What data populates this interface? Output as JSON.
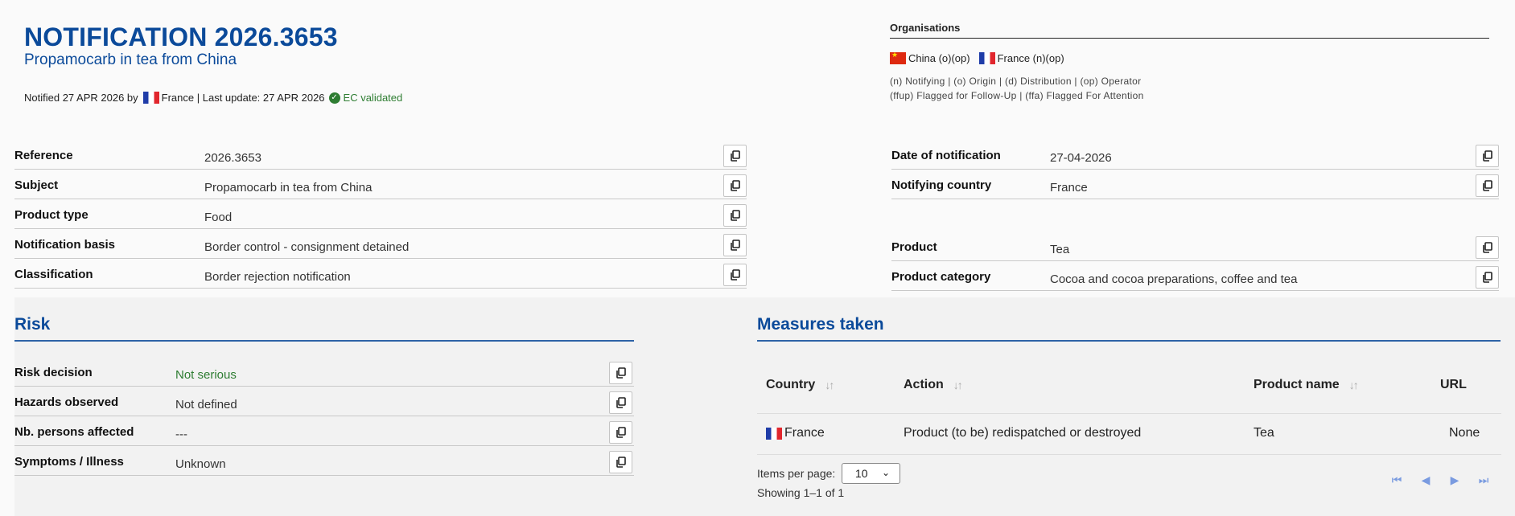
{
  "header": {
    "title": "NOTIFICATION 2026.3653",
    "subtitle": "Propamocarb in tea from China",
    "notified_prefix": "Notified 27 APR 2026 by",
    "notified_country": "France",
    "last_update": "| Last update: 27 APR 2026",
    "validated": "EC validated"
  },
  "organisations": {
    "title": "Organisations",
    "entries": [
      {
        "country": "China (o)(op)",
        "flag": "flag-china"
      },
      {
        "country": "France (n)(op)",
        "flag": "flag-france"
      }
    ],
    "legend_line1": "(n) Notifying | (o) Origin | (d) Distribution | (op) Operator",
    "legend_line2": "(ffup) Flagged for Follow-Up | (ffa) Flagged For Attention"
  },
  "fields_left": [
    {
      "label": "Reference",
      "value": "2026.3653"
    },
    {
      "label": "Subject",
      "value": "Propamocarb in tea from China"
    },
    {
      "label": "Product type",
      "value": "Food"
    },
    {
      "label": "Notification basis",
      "value": "Border control - consignment detained"
    },
    {
      "label": "Classification",
      "value": "Border rejection notification"
    }
  ],
  "fields_right": [
    {
      "label": "Date of notification",
      "value": "27-04-2026"
    },
    {
      "label": "Notifying country",
      "value": "France"
    },
    {
      "label": "Product",
      "value": "Tea"
    },
    {
      "label": "Product category",
      "value": "Cocoa and cocoa preparations, coffee and tea"
    }
  ],
  "risk": {
    "title": "Risk",
    "fields": [
      {
        "label": "Risk decision",
        "value": "Not serious",
        "color": "#2e7d32"
      },
      {
        "label": "Hazards observed",
        "value": "Not defined"
      },
      {
        "label": "Nb. persons affected",
        "value": "---"
      },
      {
        "label": "Symptoms / Illness",
        "value": "Unknown"
      }
    ]
  },
  "measures": {
    "title": "Measures taken",
    "columns": [
      "Country",
      "Action",
      "Product name",
      "URL"
    ],
    "rows": [
      {
        "country": "France",
        "action": "Product (to be) redispatched or destroyed",
        "product_name": "Tea",
        "url": "None"
      }
    ],
    "items_per_page_label": "Items per page:",
    "items_per_page_value": "10",
    "showing": "Showing 1–1 of 1"
  },
  "icons": {
    "copy": "copy-icon",
    "sort": "sort-icon",
    "pager": [
      "first-page-icon",
      "previous-page-icon",
      "next-page-icon",
      "last-page-icon"
    ],
    "check": "check-circle-icon"
  },
  "colors": {
    "brand": "#0b4a9a",
    "validated": "#2e7d32",
    "pager": "#7a9be0"
  }
}
